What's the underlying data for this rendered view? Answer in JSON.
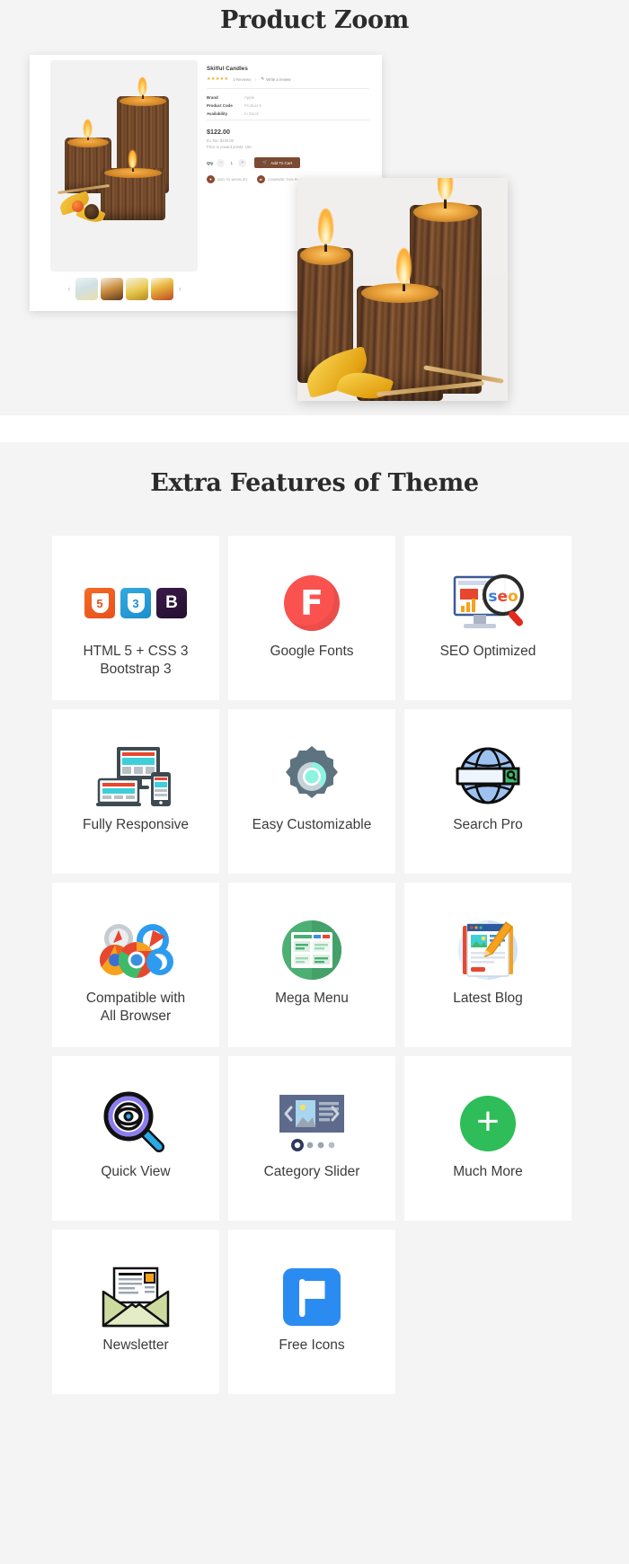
{
  "zoom_section": {
    "title": "Product Zoom",
    "product": {
      "name": "Skilful Candles",
      "stars": "★★★★★",
      "reviews": "2 Reviews",
      "review_separator": "|",
      "write_review": "Write a review",
      "specs": [
        {
          "key": "Brand",
          "value": "Apple"
        },
        {
          "key": "Product Code",
          "value": "Product 9"
        },
        {
          "key": "Availability",
          "value": "In Stock"
        }
      ],
      "price": "$122.00",
      "ex_tax": "Ex Tax: $100.00",
      "reward_points": "Price in reward points: 100",
      "qty_label": "Qty",
      "qty_minus": "−",
      "qty_value": "1",
      "qty_plus": "+",
      "add_to_cart": "Add To Cart",
      "cart_icon": "shopping-cart-icon",
      "wishlist": "ADD TO WISHLIST",
      "wishlist_icon": "heart-icon",
      "compare": "COMPARE THIS PRODUCT",
      "compare_icon": "exchange-icon",
      "carousel_prev": "‹",
      "carousel_next": "›",
      "thumbnails": [
        "thumbnail-candles-pastel",
        "thumbnail-candle-wood",
        "thumbnail-candle-gold",
        "thumbnail-candle-autumn"
      ]
    },
    "zoom_popup_alt": "zoomed-candle-image"
  },
  "features_section": {
    "title": "Extra Features of Theme",
    "cards": [
      {
        "label": "HTML 5 + CSS 3\nBootstrap 3",
        "label_line1": "HTML 5 + CSS 3",
        "label_line2": "Bootstrap 3",
        "icon": "html5-css3-bootstrap-icon",
        "badges": [
          {
            "text": "5",
            "name": "html5-badge"
          },
          {
            "text": "3",
            "name": "css3-badge"
          },
          {
            "text": "B",
            "name": "bootstrap-badge"
          }
        ]
      },
      {
        "label": "Google Fonts",
        "icon": "google-fonts-icon",
        "glyph": "F"
      },
      {
        "label": "SEO Optimized",
        "icon": "seo-optimized-icon",
        "seo_text": "seo"
      },
      {
        "label": "Fully Responsive",
        "icon": "responsive-devices-icon"
      },
      {
        "label": "Easy Customizable",
        "icon": "gear-icon"
      },
      {
        "label": "Search Pro",
        "icon": "globe-search-icon"
      },
      {
        "label": "Compatible with\nAll Browser",
        "label_line1": "Compatible with",
        "label_line2": "All Browser",
        "icon": "browsers-icon"
      },
      {
        "label": "Mega Menu",
        "icon": "mega-menu-icon"
      },
      {
        "label": "Latest Blog",
        "icon": "latest-blog-icon"
      },
      {
        "label": "Quick View",
        "icon": "quick-view-magnifier-eye-icon"
      },
      {
        "label": "Category Slider",
        "icon": "category-slider-icon"
      },
      {
        "label": "Much More",
        "icon": "plus-circle-icon",
        "glyph": "+"
      },
      {
        "label": "Newsletter",
        "icon": "newsletter-envelope-icon"
      },
      {
        "label": "Free Icons",
        "icon": "free-icons-flag-icon"
      }
    ]
  },
  "colors": {
    "page_background": "#f4f4f4",
    "card_background": "#ffffff",
    "heading": "#2b2b2b",
    "label": "#3b3b3b",
    "add_to_cart": "#7a4a32",
    "star": "#f0a91e",
    "html5": "#e8511c",
    "css3": "#1a8fcd",
    "bootstrap": "#24102f",
    "google_fonts": "#f9524f",
    "much_more": "#2ebd59",
    "mega_menu": "#4caf73",
    "free_icons": "#2a8cf0"
  }
}
